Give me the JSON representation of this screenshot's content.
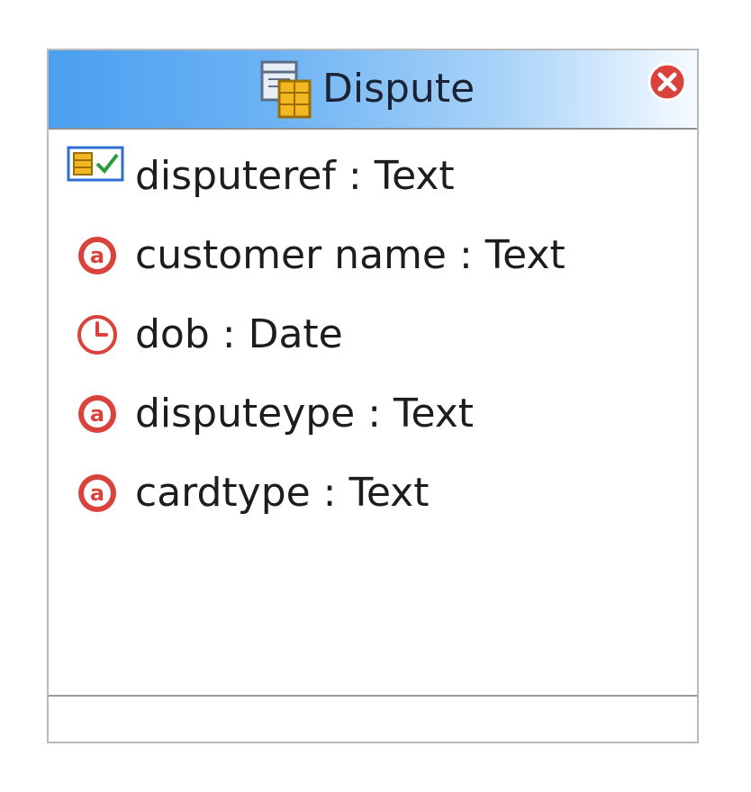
{
  "entity": {
    "title": "Dispute",
    "attributes": [
      {
        "label": "disputeref : Text",
        "icon": "key-attribute-icon"
      },
      {
        "label": "customer name : Text",
        "icon": "text-type-icon"
      },
      {
        "label": "dob : Date",
        "icon": "clock-icon"
      },
      {
        "label": "disputeype : Text",
        "icon": "text-type-icon"
      },
      {
        "label": "cardtype : Text",
        "icon": "text-type-icon"
      }
    ]
  },
  "colors": {
    "header_gradient_start": "#4a9ff0",
    "header_gradient_end": "#f6fbff",
    "close_button": "#d9433c",
    "type_icon": "#d9433c"
  }
}
